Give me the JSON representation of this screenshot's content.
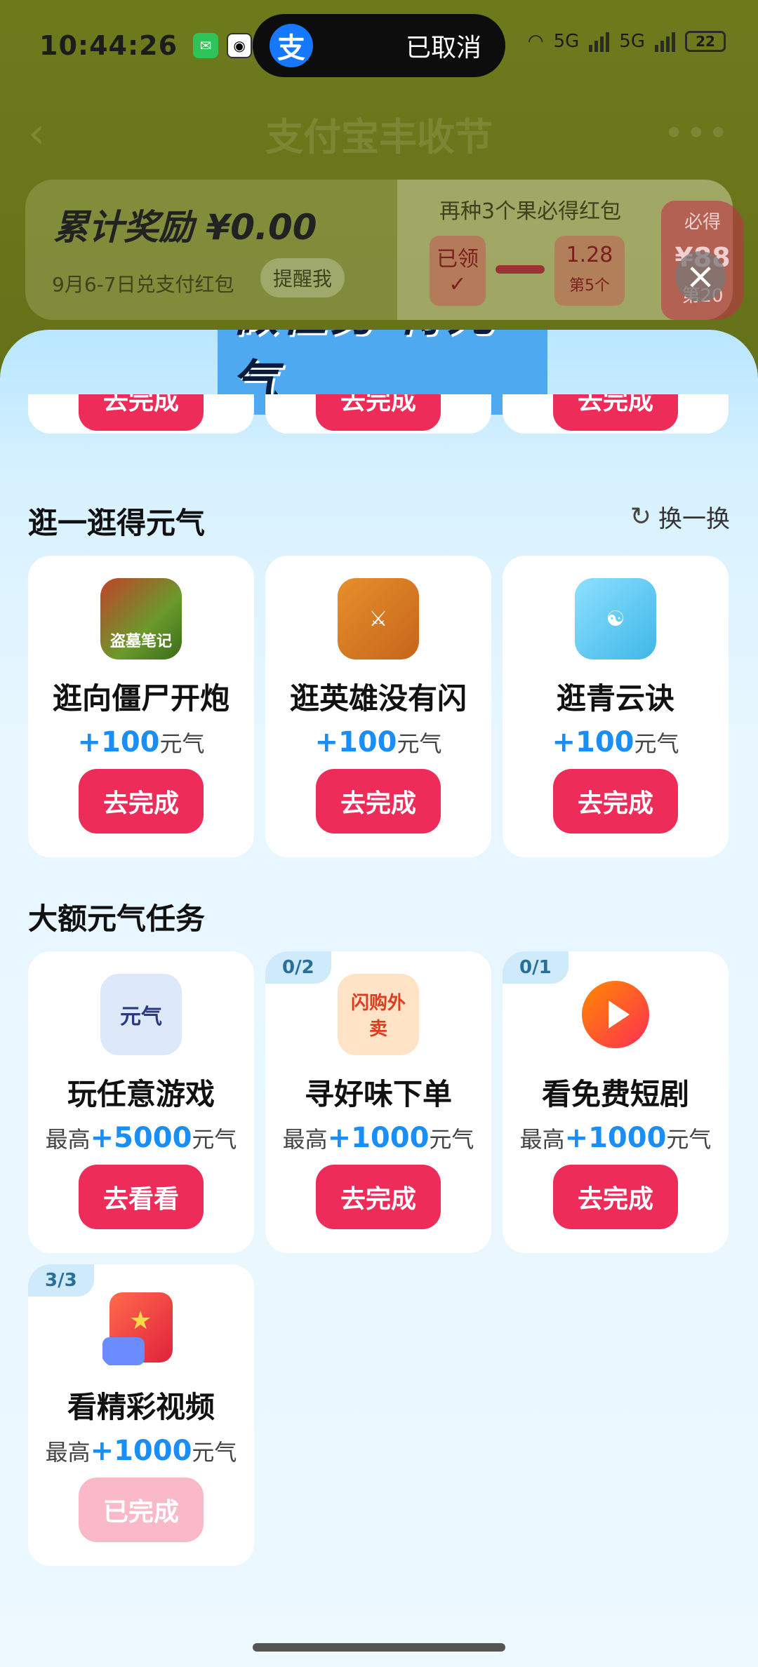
{
  "status_bar": {
    "time": "10:44:26",
    "battery": "22",
    "network_1": "5G",
    "network_2": "5G"
  },
  "dynamic_island": {
    "app_glyph": "支",
    "text": "已取消"
  },
  "background_page": {
    "title": "支付宝丰收节",
    "reward_label": "累计奖励 ¥0.00",
    "redeem_date": "9月6-7日兑支付红包",
    "remind_button": "提醒我",
    "fruit_title": "再种3个果必得红包",
    "claimed_label": "已领",
    "next_value": "1.28",
    "next_index": "第5个",
    "must_get_label": "必得",
    "must_get_value": "¥88",
    "must_get_index": "第20"
  },
  "sheet": {
    "banner": "做任务 得元气",
    "top_buttons": [
      "去完成",
      "去完成",
      "去完成"
    ],
    "browse_section": {
      "title": "逛一逛得元气",
      "refresh_label": "换一换",
      "cards": [
        {
          "icon": "zombie-game-icon",
          "icon_text": "盗墓笔记",
          "name": "逛向僵尸开炮",
          "amount": "+100",
          "unit": "元气",
          "button": "去完成"
        },
        {
          "icon": "hero-game-icon",
          "icon_text": "",
          "name": "逛英雄没有闪",
          "amount": "+100",
          "unit": "元气",
          "button": "去完成"
        },
        {
          "icon": "qingyun-game-icon",
          "icon_text": "",
          "name": "逛青云诀",
          "amount": "+100",
          "unit": "元气",
          "button": "去完成"
        }
      ]
    },
    "big_section": {
      "title": "大额元气任务",
      "cards": [
        {
          "badge": "",
          "icon": "yuanqi-icon",
          "icon_text": "元气",
          "name": "玩任意游戏",
          "prefix": "最高",
          "amount": "+5000",
          "unit": "元气",
          "button": "去看看",
          "done": false
        },
        {
          "badge": "0/2",
          "icon": "shangou-icon",
          "icon_text": "闪购外卖",
          "name": "寻好味下单",
          "prefix": "最高",
          "amount": "+1000",
          "unit": "元气",
          "button": "去完成",
          "done": false
        },
        {
          "badge": "0/1",
          "icon": "video-play-icon",
          "icon_text": "",
          "name": "看免费短剧",
          "prefix": "最高",
          "amount": "+1000",
          "unit": "元气",
          "button": "去完成",
          "done": false
        },
        {
          "badge": "3/3",
          "icon": "red-packet-video-icon",
          "icon_text": "",
          "name": "看精彩视频",
          "prefix": "最高",
          "amount": "+1000",
          "unit": "元气",
          "button": "已完成",
          "done": true
        }
      ]
    }
  },
  "colors": {
    "accent_button": "#ee2c5a",
    "done_button": "#f9b9c8",
    "amount_blue": "#1a8ef5"
  }
}
